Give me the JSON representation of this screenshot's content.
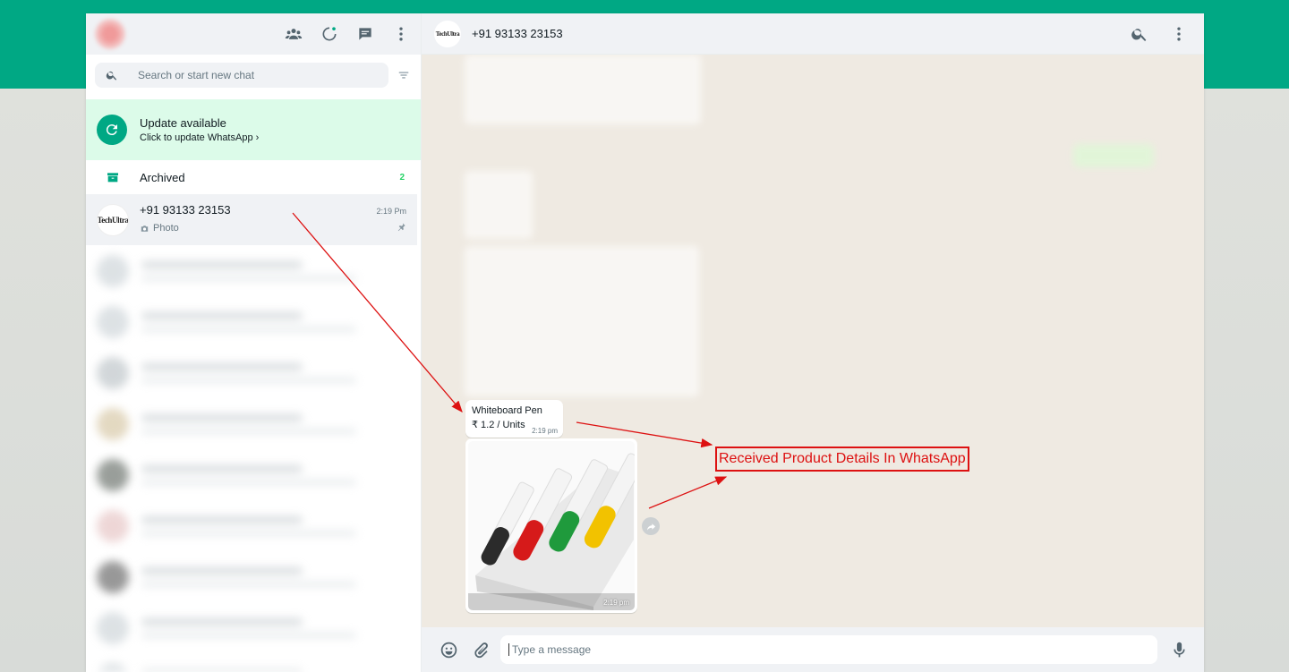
{
  "sidebar": {
    "search_placeholder": "Search or start new chat",
    "update": {
      "title": "Update available",
      "subtitle": "Click to update WhatsApp ›"
    },
    "archived": {
      "label": "Archived",
      "count": "2"
    },
    "active_chat": {
      "name": "+91 93133 23153",
      "time": "2:19 Pm",
      "preview": "Photo",
      "avatar_logo": "TechUltra"
    }
  },
  "conversation": {
    "header_name": "+91 93133 23153",
    "product": {
      "name": "Whiteboard Pen",
      "price": "₹ 1.2 / Units",
      "time": "2:19 pm"
    },
    "image_time": "2:19 pm",
    "annotation": "Received Product Details In WhatsApp",
    "composer_placeholder": "Type a message"
  },
  "colors": {
    "brand": "#00a884",
    "update_banner": "#dcfbe9",
    "annotation": "#dd1111",
    "unread_count": "#25d366"
  },
  "icons": {
    "header": [
      "community-icon",
      "status-icon",
      "new-chat-icon",
      "menu-icon"
    ],
    "chat_header": [
      "search-icon",
      "menu-icon"
    ],
    "composer": [
      "emoji-icon",
      "attach-icon",
      "mic-icon"
    ]
  }
}
